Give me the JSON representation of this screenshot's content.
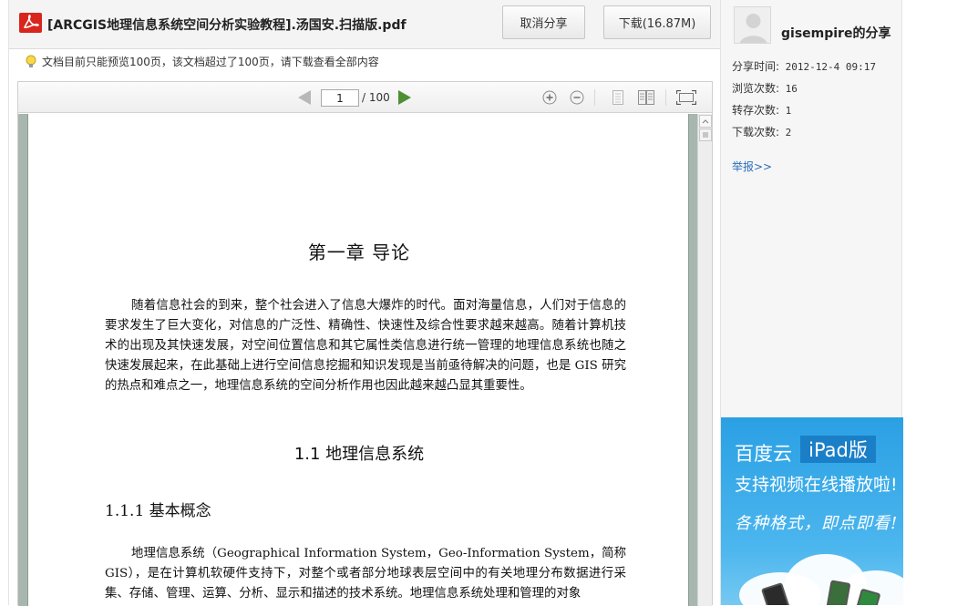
{
  "header": {
    "file_title": "[ARCGIS地理信息系统空间分析实验教程].汤国安.扫描版.pdf",
    "cancel_share_label": "取消分享",
    "download_label": "下载(16.87M)"
  },
  "notice": {
    "text": "文档目前只能预览100页，该文档超过了100页，请下载查看全部内容"
  },
  "viewer": {
    "current_page": "1",
    "total_pages": "/ 100"
  },
  "document": {
    "chapter_title": "第一章  导论",
    "paragraph1": "随着信息社会的到来，整个社会进入了信息大爆炸的时代。面对海量信息，人们对于信息的要求发生了巨大变化，对信息的广泛性、精确性、快速性及综合性要求越来越高。随着计算机技术的出现及其快速发展，对空间位置信息和其它属性类信息进行统一管理的地理信息系统也随之快速发展起来，在此基础上进行空间信息挖掘和知识发现是当前亟待解决的问题，也是 GIS 研究的热点和难点之一，地理信息系统的空间分析作用也因此越来越凸显其重要性。",
    "section_title": "1.1  地理信息系统",
    "subsection_title": "1.1.1  基本概念",
    "paragraph2": "地理信息系统（Geographical Information System，Geo-Information System，简称 GIS），是在计算机软硬件支持下，对整个或者部分地球表层空间中的有关地理分布数据进行采集、存储、管理、运算、分析、显示和描述的技术系统。地理信息系统处理和管理的对象"
  },
  "sidebar": {
    "username": "gisempire的分享",
    "share_time_label": "分享时间:",
    "share_time_value": "2012-12-4 09:17",
    "views_label": "浏览次数:",
    "views_value": "16",
    "saves_label": "转存次数:",
    "saves_value": "1",
    "downloads_label": "下载次数:",
    "downloads_value": "2",
    "report_label": "举报>>"
  },
  "ad": {
    "brand": "百度云",
    "badge": "iPad版",
    "subtitle": "支持视频在线播放啦!",
    "slogan": "各种格式，即点即看!"
  },
  "colors": {
    "accent_red": "#d9261c",
    "link_blue": "#2a6ebb",
    "ad_blue": "#2aa0e4",
    "next_green": "#4e8f34"
  }
}
